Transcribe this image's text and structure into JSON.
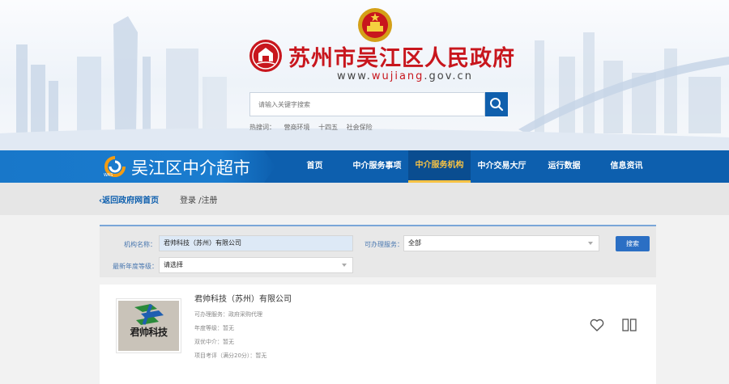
{
  "header": {
    "site_title": "苏州市吴江区人民政府",
    "site_url_prefix": "www.",
    "site_url_highlight": "wujiang",
    "site_url_suffix": ".gov.cn",
    "search_placeholder": "请输入关键字搜索",
    "hot_label": "热搜词：",
    "hot_words": [
      "营商环境",
      "十四五",
      "社会保险"
    ],
    "search_icon": "search-icon",
    "emblem_icon": "national-emblem",
    "logo_icon": "wujiang-gov-logo"
  },
  "navbar": {
    "brand_title": "吴江区中介超市",
    "brand_caption": "WAS",
    "items": [
      {
        "label": "首页",
        "active": false
      },
      {
        "label": "中介服务事项",
        "active": false
      },
      {
        "label": "中介服务机构",
        "active": true
      },
      {
        "label": "中介交易大厅",
        "active": false
      },
      {
        "label": "运行数据",
        "active": false
      },
      {
        "label": "信息资讯",
        "active": false
      }
    ],
    "active_color": "#f6c244",
    "bg_color": "#0d5fae"
  },
  "breadcrumb": {
    "back_label": "返回政府网首页",
    "login_label": "登录 /注册"
  },
  "filter": {
    "org_name_label": "机构名称：",
    "org_name_value": "君帅科技（苏州）有限公司",
    "service_label": "可办理服务：",
    "service_value": "全部",
    "grade_label": "最新年度等级：",
    "grade_value": "请选择",
    "search_button": "搜索"
  },
  "results": [
    {
      "company_name": "君帅科技（苏州）有限公司",
      "logo_text": "君帅科技",
      "services": "可办理服务：政府采购代理",
      "annual_grade": "年度等级：暂无",
      "dual_excellent": "双优中介：暂无",
      "project_rating": "项目考评（满分20分）：暂无",
      "favorite_icon": "heart-icon",
      "compare_icon": "compare-icon"
    }
  ]
}
